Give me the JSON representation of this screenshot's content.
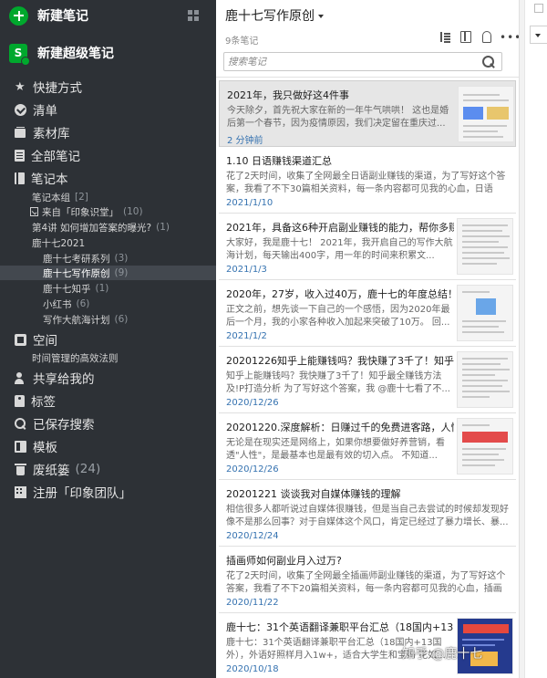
{
  "sidebar": {
    "new_note": "新建笔记",
    "new_super_note": "新建超级笔记",
    "super_icon_letter": "S",
    "nav": [
      {
        "label": "快捷方式",
        "icon": "star-icon"
      },
      {
        "label": "清单",
        "icon": "check-circle-icon"
      },
      {
        "label": "素材库",
        "icon": "library-icon"
      },
      {
        "label": "全部笔记",
        "icon": "notes-icon"
      },
      {
        "label": "笔记本",
        "icon": "notebook-icon"
      }
    ],
    "notebooks": [
      {
        "label": "笔记本组",
        "count": "[2]"
      },
      {
        "label": "来自「印象识堂」",
        "count": "(10)"
      },
      {
        "label": "第4讲 如何增加答案的曝光?",
        "count": "(1)"
      },
      {
        "label": "鹿十七2021",
        "count": ""
      },
      {
        "label": "鹿十七考研系列",
        "count": "(3)"
      },
      {
        "label": "鹿十七写作原创",
        "count": "(9)"
      },
      {
        "label": "鹿十七知乎",
        "count": "(1)"
      },
      {
        "label": "小红书",
        "count": "(6)"
      },
      {
        "label": "写作大航海计划",
        "count": "(6)"
      }
    ],
    "space": {
      "label": "空间",
      "icon": "space-icon"
    },
    "space_item": "时间管理的高效法则",
    "nav2": [
      {
        "label": "共享给我的",
        "icon": "shared-users-icon",
        "count": ""
      },
      {
        "label": "标签",
        "icon": "tag-icon",
        "count": ""
      },
      {
        "label": "已保存搜索",
        "icon": "search-icon",
        "count": ""
      },
      {
        "label": "模板",
        "icon": "template-icon",
        "count": ""
      },
      {
        "label": "废纸篓",
        "icon": "trash-icon",
        "count": "(24)"
      },
      {
        "label": "注册「印象团队」",
        "icon": "building-icon",
        "count": ""
      }
    ]
  },
  "list": {
    "notebook_title": "鹿十七写作原创",
    "note_count": "9条笔记",
    "search_placeholder": "搜索笔记",
    "toolbar_more": "•••",
    "notes": [
      {
        "title": "2021年，我只做好这4件事",
        "snippet": "今天除夕，首先祝大家在新的一年牛气哄哄！ 这也是婚后第一个春节，因为疫情原因，我们决定留在重庆过...",
        "date": "2 分钟前",
        "thumb": true
      },
      {
        "title": "1.10 日语赚钱渠道汇总",
        "snippet": "花了2天时间，收集了全网最全日语副业赚钱的渠道，为了写好这个答案，我看了不下30篇相关资料，每一条内容都可见我的心血，日语学...",
        "date": "2021/1/10",
        "thumb": false
      },
      {
        "title": "2021年，具备这6种开启副业赚钱的能力，帮你多赚1...",
        "snippet": "大家好，我是鹿十七！ 2021年，我开启自己的写作大航海计划，每天输出400字，用一年的时间来积累文...",
        "date": "2021/1/3",
        "thumb": true
      },
      {
        "title": "2020年，27岁，收入过40万，鹿十七的年度总结！",
        "snippet": "正文之前，想先谈一下自己的一个感悟，因为2020年最后一个月，我的小家各种收入加起来突破了10万。 回...",
        "date": "2021/1/2",
        "thumb": true
      },
      {
        "title": "20201226知乎上能赚钱吗？我快赚了3千了！知乎最...",
        "snippet": "知乎上能赚钱吗？我快赚了3千了！知乎最全赚钱方法及!P打造分析 为了写好这个答案，我 @鹿十七看了不...",
        "date": "2020/12/26",
        "thumb": true
      },
      {
        "title": "20201220.深度解析：日赚过千的免费进客路，人性...",
        "snippet": "无论是在现实还是网络上，如果你想要做好养营销，看透\"人性\"，是最基本也是最有效的切入点。 不知道...",
        "date": "2020/12/26",
        "thumb": true
      },
      {
        "title": "20201221 谈谈我对自媒体赚钱的理解",
        "snippet": "相信很多人都听说过自媒体很赚钱，但是当自己去尝试的时候却发现好像不是那么回事？对于自媒体这个风口，肯定已经过了暴力增长、暴...",
        "date": "2020/12/24",
        "thumb": false
      },
      {
        "title": "插画师如何副业月入过万?",
        "snippet": "花了2天时间，收集了全网最全插画师副业赚钱的渠道，为了写好这个答案，我看了不下20篇相关资料，每一条内容都可见我的心血，插画师...",
        "date": "2020/11/22",
        "thumb": false
      },
      {
        "title": "鹿十七：31个英语翻译兼职平台汇总（18国内+13国...",
        "snippet": "鹿十七：31个英语翻译兼职平台汇总（18国内+13国外），外语好照样月入1w+，适合大学生和宝妈 花如...",
        "date": "2020/10/18",
        "thumb": true
      }
    ]
  },
  "watermark": "知乎 @鹿十七",
  "colors": {
    "sidebar_bg": "#2d3136",
    "accent_green": "#00a82d",
    "date_blue": "#3572b0",
    "selected_bg": "#e6e6e6"
  }
}
